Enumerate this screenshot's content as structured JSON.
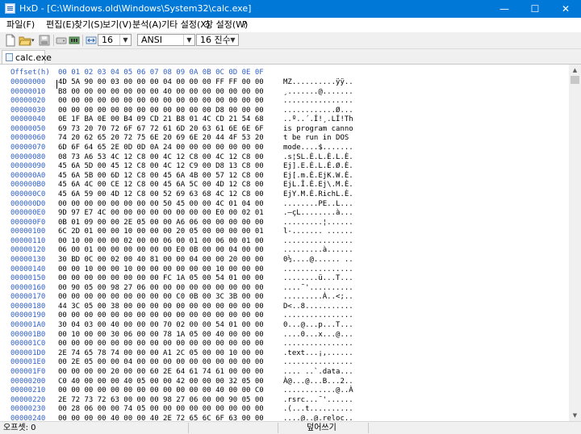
{
  "window": {
    "title": "HxD - [C:\\Windows.old\\Windows\\System32\\calc.exe]",
    "minimize": "—",
    "maximize": "☐",
    "close": "✕"
  },
  "menu": [
    "파일(F)",
    "편집(E)",
    "찾기(S)",
    "보기(V)",
    "분석(A)",
    "기타 설정(X)",
    "창 설정(W)",
    "?"
  ],
  "toolbar": {
    "bytes_per_row": "16",
    "charset": "ANSI",
    "offset_base": "16 진수"
  },
  "tab": {
    "label": "calc.exe"
  },
  "editor": {
    "offset_header": "Offset(h)",
    "column_header": "00 01 02 03 04 05 06 07 08 09 0A 0B 0C 0D 0E 0F",
    "offsets": [
      "00000000",
      "00000010",
      "00000020",
      "00000030",
      "00000040",
      "00000050",
      "00000060",
      "00000070",
      "00000080",
      "00000090",
      "000000A0",
      "000000B0",
      "000000C0",
      "000000D0",
      "000000E0",
      "000000F0",
      "00000100",
      "00000110",
      "00000120",
      "00000130",
      "00000140",
      "00000150",
      "00000160",
      "00000170",
      "00000180",
      "00000190",
      "000001A0",
      "000001B0",
      "000001C0",
      "000001D0",
      "000001E0",
      "000001F0",
      "00000200",
      "00000210",
      "00000220",
      "00000230",
      "00000240"
    ],
    "hex": [
      "4D 5A 90 00 03 00 00 00 04 00 00 00 FF FF 00 00",
      "B8 00 00 00 00 00 00 00 40 00 00 00 00 00 00 00",
      "00 00 00 00 00 00 00 00 00 00 00 00 00 00 00 00",
      "00 00 00 00 00 00 00 00 00 00 00 00 D8 00 00 00",
      "0E 1F BA 0E 00 B4 09 CD 21 B8 01 4C CD 21 54 68",
      "69 73 20 70 72 6F 67 72 61 6D 20 63 61 6E 6E 6F",
      "74 20 62 65 20 72 75 6E 20 69 6E 20 44 4F 53 20",
      "6D 6F 64 65 2E 0D 0D 0A 24 00 00 00 00 00 00 00",
      "08 73 A6 53 4C 12 C8 00 4C 12 C8 00 4C 12 C8 00",
      "45 6A 5D 00 45 12 C8 00 4C 12 C9 00 D8 13 C8 00",
      "45 6A 5B 00 6D 12 C8 00 45 6A 4B 00 57 12 C8 00",
      "45 6A 4C 00 CE 12 C8 00 45 6A 5C 00 4D 12 C8 00",
      "45 6A 59 00 4D 12 C8 00 52 69 63 68 4C 12 C8 00",
      "00 00 00 00 00 00 00 00 50 45 00 00 4C 01 04 00",
      "9D 97 E7 4C 00 00 00 00 00 00 00 00 E0 00 02 01",
      "0B 01 09 00 00 2E 05 00 00 A6 06 00 00 00 00 00",
      "6C 2D 01 00 00 10 00 00 00 20 05 00 00 00 00 01",
      "00 10 00 00 00 02 00 00 06 00 01 00 06 00 01 00",
      "06 00 01 00 00 00 00 00 00 E0 0B 00 00 04 00 00",
      "30 BD 0C 00 02 00 40 81 00 00 04 00 00 20 00 00",
      "00 00 10 00 00 10 00 00 00 00 00 00 10 00 00 00",
      "00 00 00 00 00 00 00 00 FC 1A 05 00 54 01 00 00",
      "00 90 05 00 98 27 06 00 00 00 00 00 00 00 00 00",
      "00 00 00 00 00 00 00 00 00 C0 0B 00 3C 3B 00 00",
      "44 3C 05 00 38 00 00 00 00 00 00 00 00 00 00 00",
      "00 00 00 00 00 00 00 00 00 00 00 00 00 00 00 00",
      "30 04 03 00 40 00 00 00 70 02 00 00 54 01 00 00",
      "00 10 00 00 30 06 00 00 78 1A 05 00 40 00 00 00",
      "00 00 00 00 00 00 00 00 00 00 00 00 00 00 00 00",
      "2E 74 65 78 74 00 00 00 A1 2C 05 00 00 10 00 00",
      "00 2E 05 00 00 04 00 00 00 00 00 00 00 00 00 00",
      "00 00 00 00 20 00 00 60 2E 64 61 74 61 00 00 00",
      "C0 40 00 00 00 40 05 00 00 42 00 00 00 32 05 00",
      "00 00 00 00 00 00 00 00 00 00 00 00 40 00 00 C0",
      "2E 72 73 72 63 00 00 00 98 27 06 00 00 90 05 00",
      "00 28 06 00 00 74 05 00 00 00 00 00 00 00 00 00",
      "00 00 00 00 40 00 00 40 2E 72 65 6C 6F 63 00 00"
    ],
    "ascii": [
      "MZ..........ÿÿ..",
      "¸.......@.......",
      "................",
      "............Ø...",
      "..º..´.Í!¸.LÍ!Th",
      "is program canno",
      "t be run in DOS ",
      "mode....$.......",
      ".s¦SL.È.L.È.L.È.",
      "Ej].E.È.L.É.Ø.È.",
      "Ej[.m.È.EjK.W.È.",
      "EjL.Î.È.Ej\\.M.È.",
      "EjY.M.È.RichL.È.",
      "........PE..L...",
      ".—çL........à...",
      ".........¦......",
      "l-....... ......",
      "................",
      ".........à......",
      "0½....@...... ..",
      "................",
      "........ü...T...",
      "....˜'..........",
      ".........À..<;..",
      "D<..8...........",
      "................",
      "0...@...p...T...",
      "....0...x...@...",
      "................",
      ".text...¡,......",
      "................",
      ".... ..`.data...",
      "À@...@...B...2..",
      "............@..À",
      ".rsrc...˜'......",
      ".(...t..........",
      "....@..@.reloc.."
    ]
  },
  "status": {
    "offset": "오프셋: 0",
    "mode": "덮어쓰기"
  }
}
